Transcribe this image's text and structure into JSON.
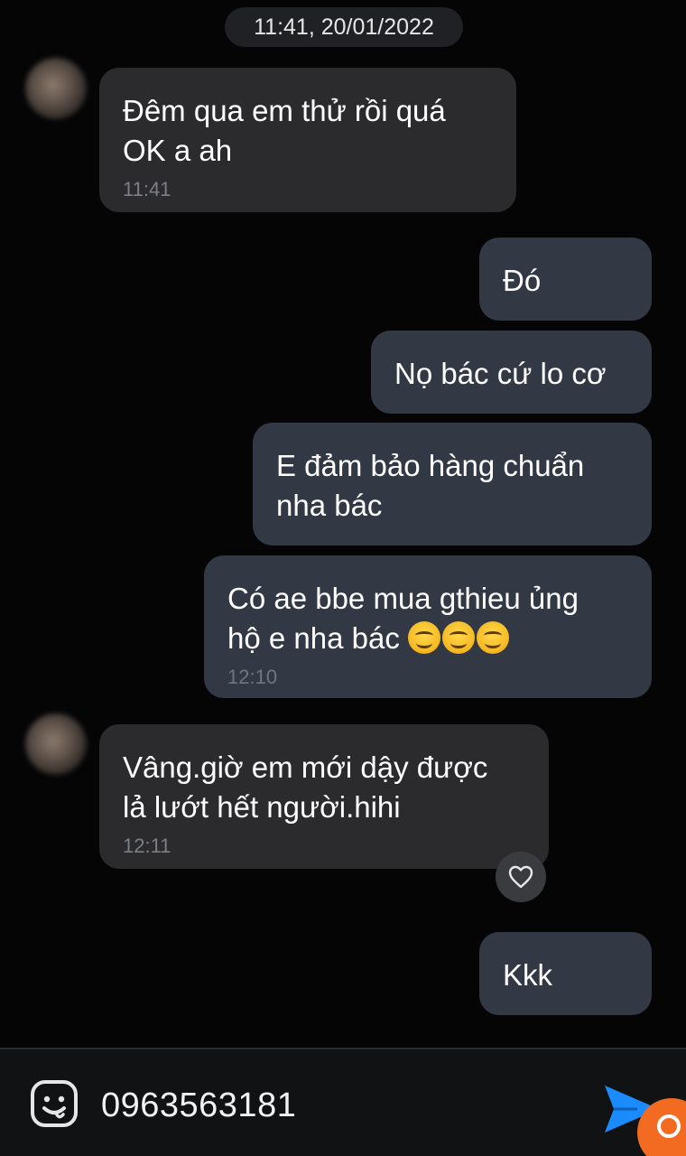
{
  "header": {
    "date_time": "11:41, 20/01/2022"
  },
  "messages": [
    {
      "direction": "in",
      "lines": [
        "Đêm qua em thử rồi quá",
        "OK a ah"
      ],
      "time": "11:41"
    },
    {
      "direction": "out",
      "lines": [
        "Đó"
      ]
    },
    {
      "direction": "out",
      "lines": [
        "Nọ bác cứ lo cơ"
      ]
    },
    {
      "direction": "out",
      "lines": [
        "E đảm bảo hàng chuẩn",
        "nha bác"
      ]
    },
    {
      "direction": "out",
      "lines": [
        "Có ae bbe mua gthieu ủng",
        "hộ e nha bác"
      ],
      "emoji": [
        "smiling-face-icon",
        "smiling-face-icon",
        "smiling-face-icon"
      ],
      "time": "12:10"
    },
    {
      "direction": "in",
      "lines": [
        "Vâng.giờ em mới dậy được",
        "lả lướt hết người.hihi"
      ],
      "time": "12:11",
      "reaction": "heart-icon"
    },
    {
      "direction": "out",
      "lines": [
        "Kkk"
      ]
    }
  ],
  "composer": {
    "input_value": "0963563181",
    "sticker_icon": "sticker-smiley-icon",
    "send_icon": "send-arrow-icon"
  },
  "colors": {
    "background": "#050506",
    "incoming_bubble": "#2b2b2d",
    "outgoing_bubble": "#323945",
    "send_accent": "#1a8cff",
    "corner_badge": "#f26b21"
  }
}
